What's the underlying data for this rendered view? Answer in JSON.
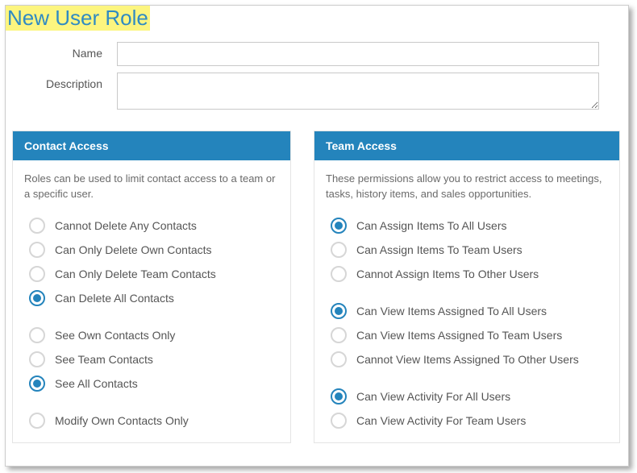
{
  "title": "New User Role",
  "form": {
    "name_label": "Name",
    "name_value": "",
    "desc_label": "Description",
    "desc_value": ""
  },
  "contact_panel": {
    "header": "Contact Access",
    "desc": "Roles can be used to limit contact access to a team or a specific user.",
    "groups": [
      {
        "options": [
          {
            "label": "Cannot Delete Any Contacts",
            "selected": false
          },
          {
            "label": "Can Only Delete Own Contacts",
            "selected": false
          },
          {
            "label": "Can Only Delete Team Contacts",
            "selected": false
          },
          {
            "label": "Can Delete All Contacts",
            "selected": true
          }
        ]
      },
      {
        "options": [
          {
            "label": "See Own Contacts Only",
            "selected": false
          },
          {
            "label": "See Team Contacts",
            "selected": false
          },
          {
            "label": "See All Contacts",
            "selected": true
          }
        ]
      },
      {
        "options": [
          {
            "label": "Modify Own Contacts Only",
            "selected": false
          }
        ]
      }
    ]
  },
  "team_panel": {
    "header": "Team Access",
    "desc": "These permissions allow you to restrict access to meetings, tasks, history items, and sales opportunities.",
    "groups": [
      {
        "options": [
          {
            "label": "Can Assign Items To All Users",
            "selected": true
          },
          {
            "label": "Can Assign Items To Team Users",
            "selected": false
          },
          {
            "label": "Cannot Assign Items To Other Users",
            "selected": false
          }
        ]
      },
      {
        "options": [
          {
            "label": "Can View Items Assigned To All Users",
            "selected": true
          },
          {
            "label": "Can View Items Assigned To Team Users",
            "selected": false
          },
          {
            "label": "Cannot View Items Assigned To Other Users",
            "selected": false
          }
        ]
      },
      {
        "options": [
          {
            "label": "Can View Activity For All Users",
            "selected": true
          },
          {
            "label": "Can View Activity For Team Users",
            "selected": false
          }
        ]
      }
    ]
  }
}
